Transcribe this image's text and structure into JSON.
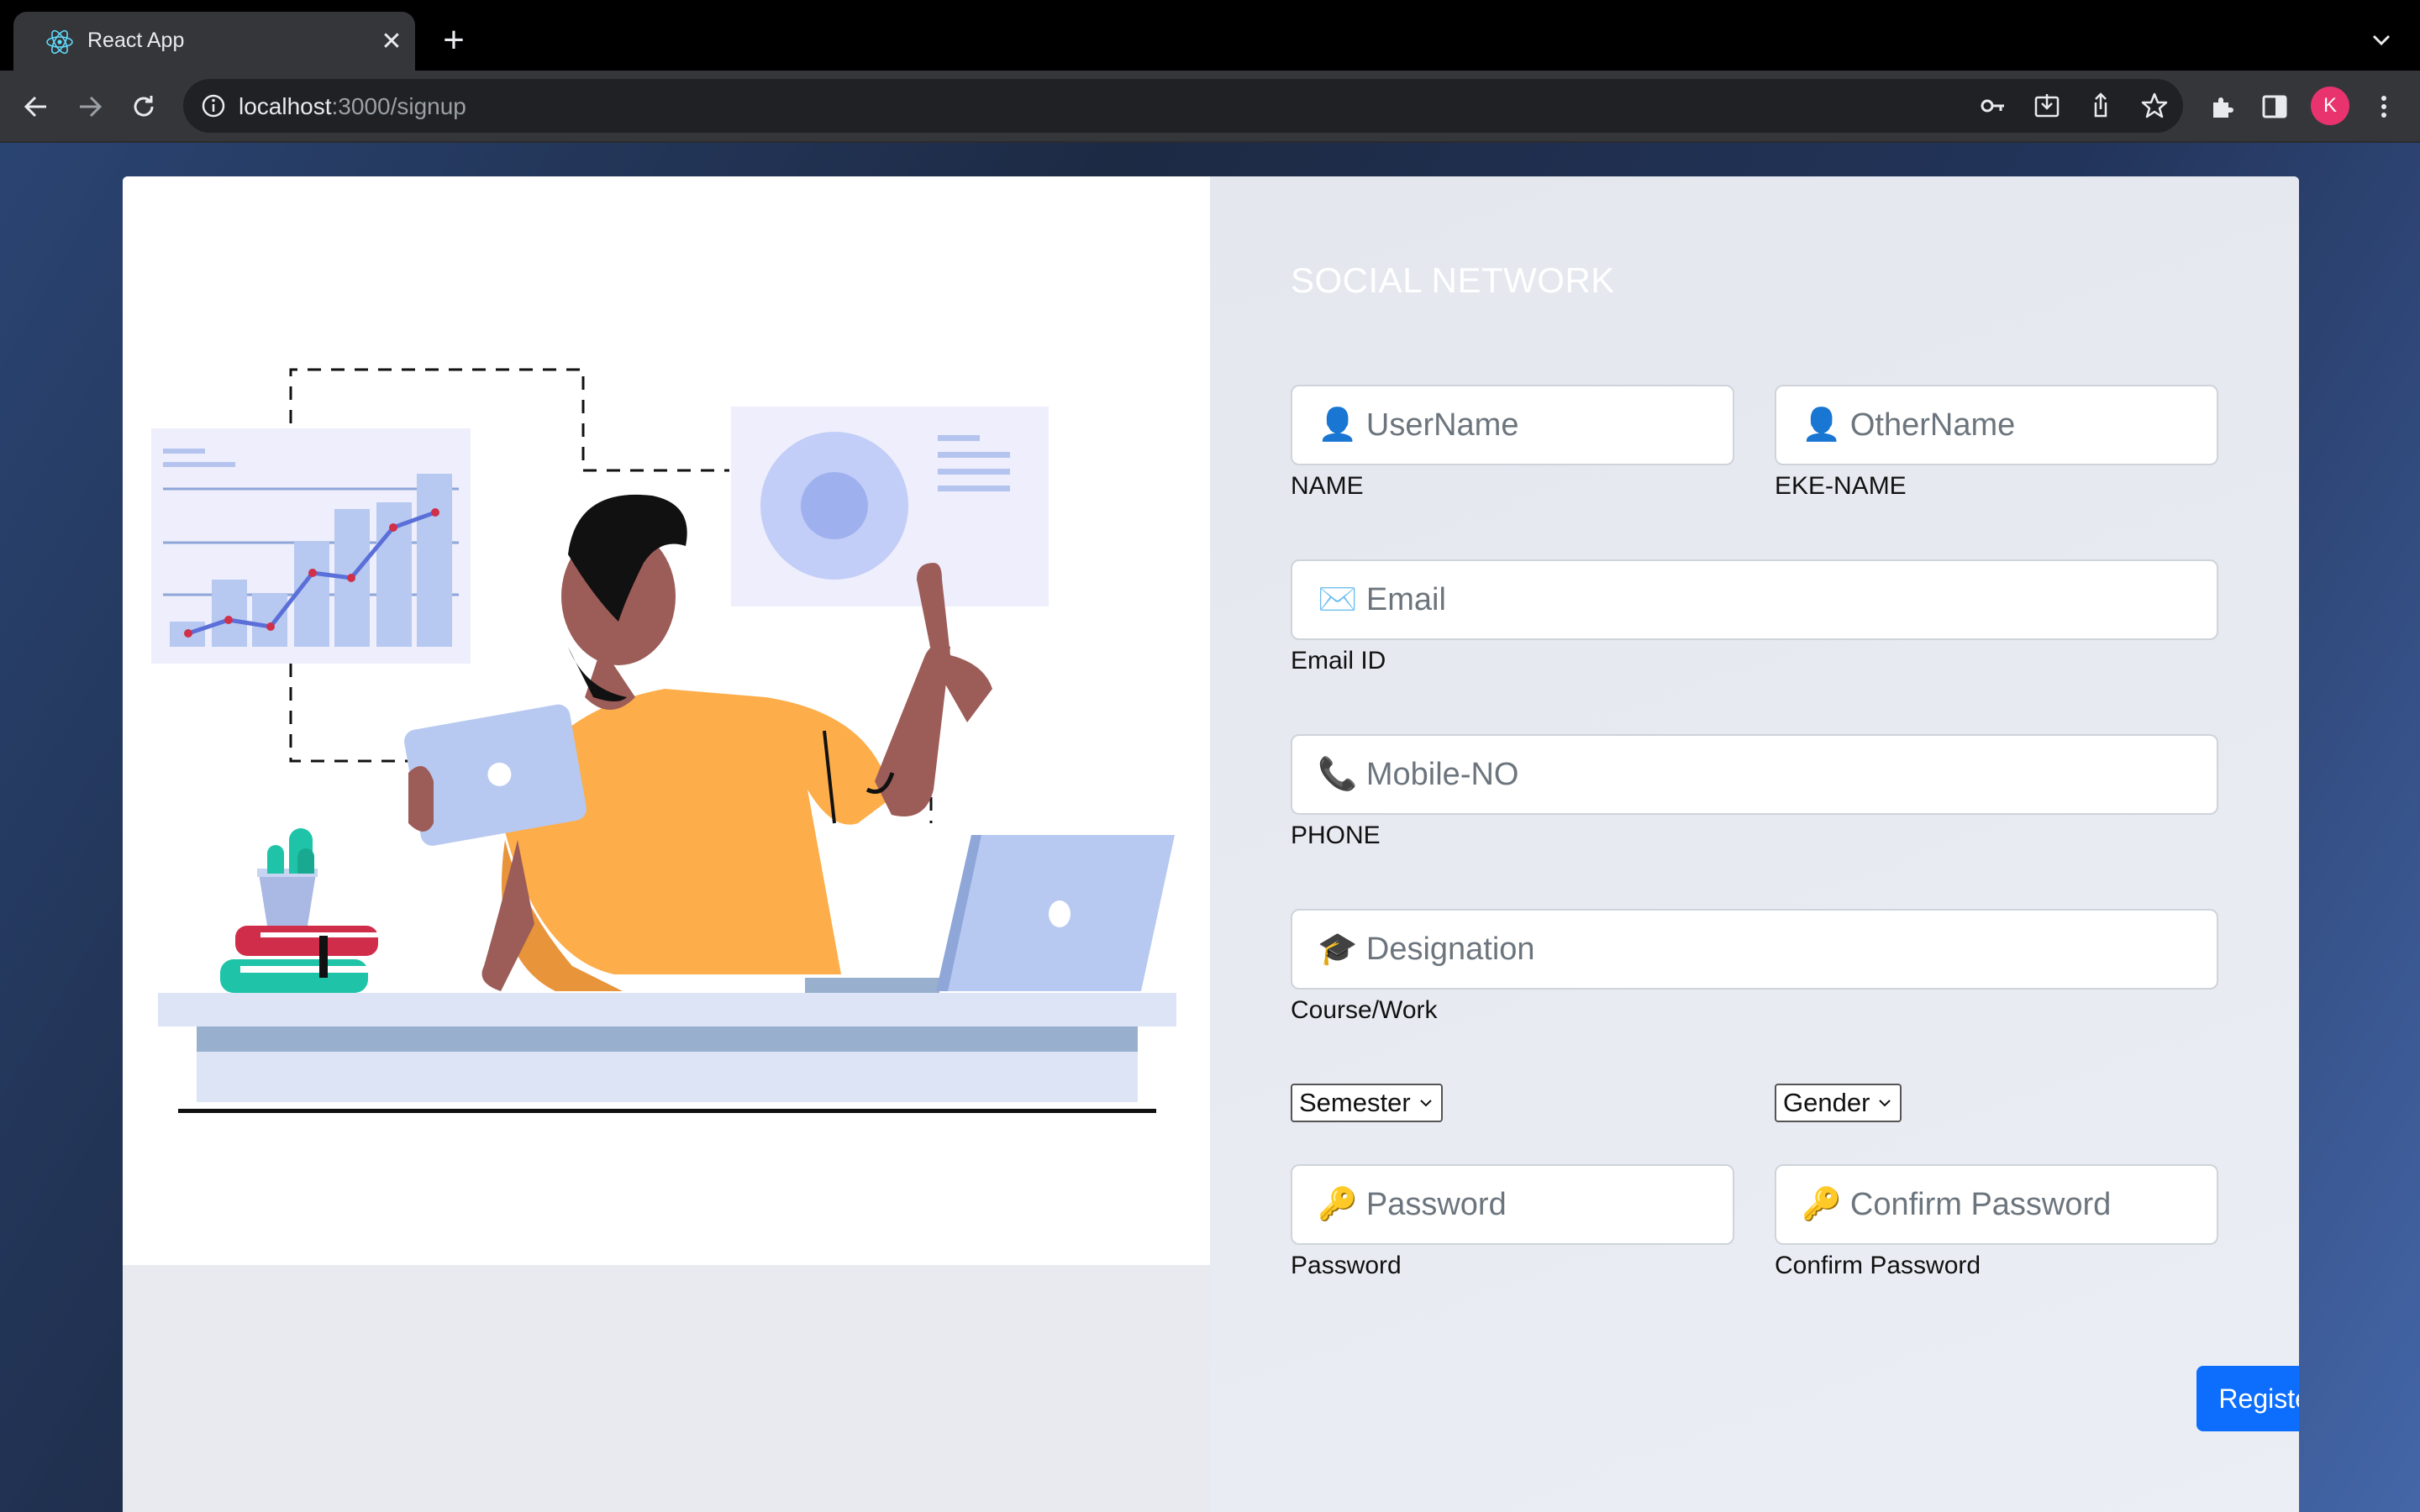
{
  "browser": {
    "tab_title": "React App",
    "url_host": "localhost",
    "url_path": ":3000/signup",
    "profile_initial": "K",
    "profile_color": "#e8336f"
  },
  "form": {
    "brand": "SOCIAL NETWORK",
    "username": {
      "placeholder": "👤 UserName",
      "label": "NAME"
    },
    "othername": {
      "placeholder": "👤 OtherName",
      "label": "EKE-NAME"
    },
    "email": {
      "placeholder": "✉️ Email",
      "label": "Email ID"
    },
    "mobile": {
      "placeholder": "📞 Mobile-NO",
      "label": "PHONE"
    },
    "designation": {
      "placeholder": "🎓 Designation",
      "label": "Course/Work"
    },
    "semester_select": "Semester",
    "gender_select": "Gender",
    "password": {
      "placeholder": "🔑 Password",
      "label": "Password"
    },
    "confirm_password": {
      "placeholder": "🔑 Confirm Password",
      "label": "Confirm Password"
    },
    "register_label": "Register",
    "accent_color": "#0d6efd"
  }
}
